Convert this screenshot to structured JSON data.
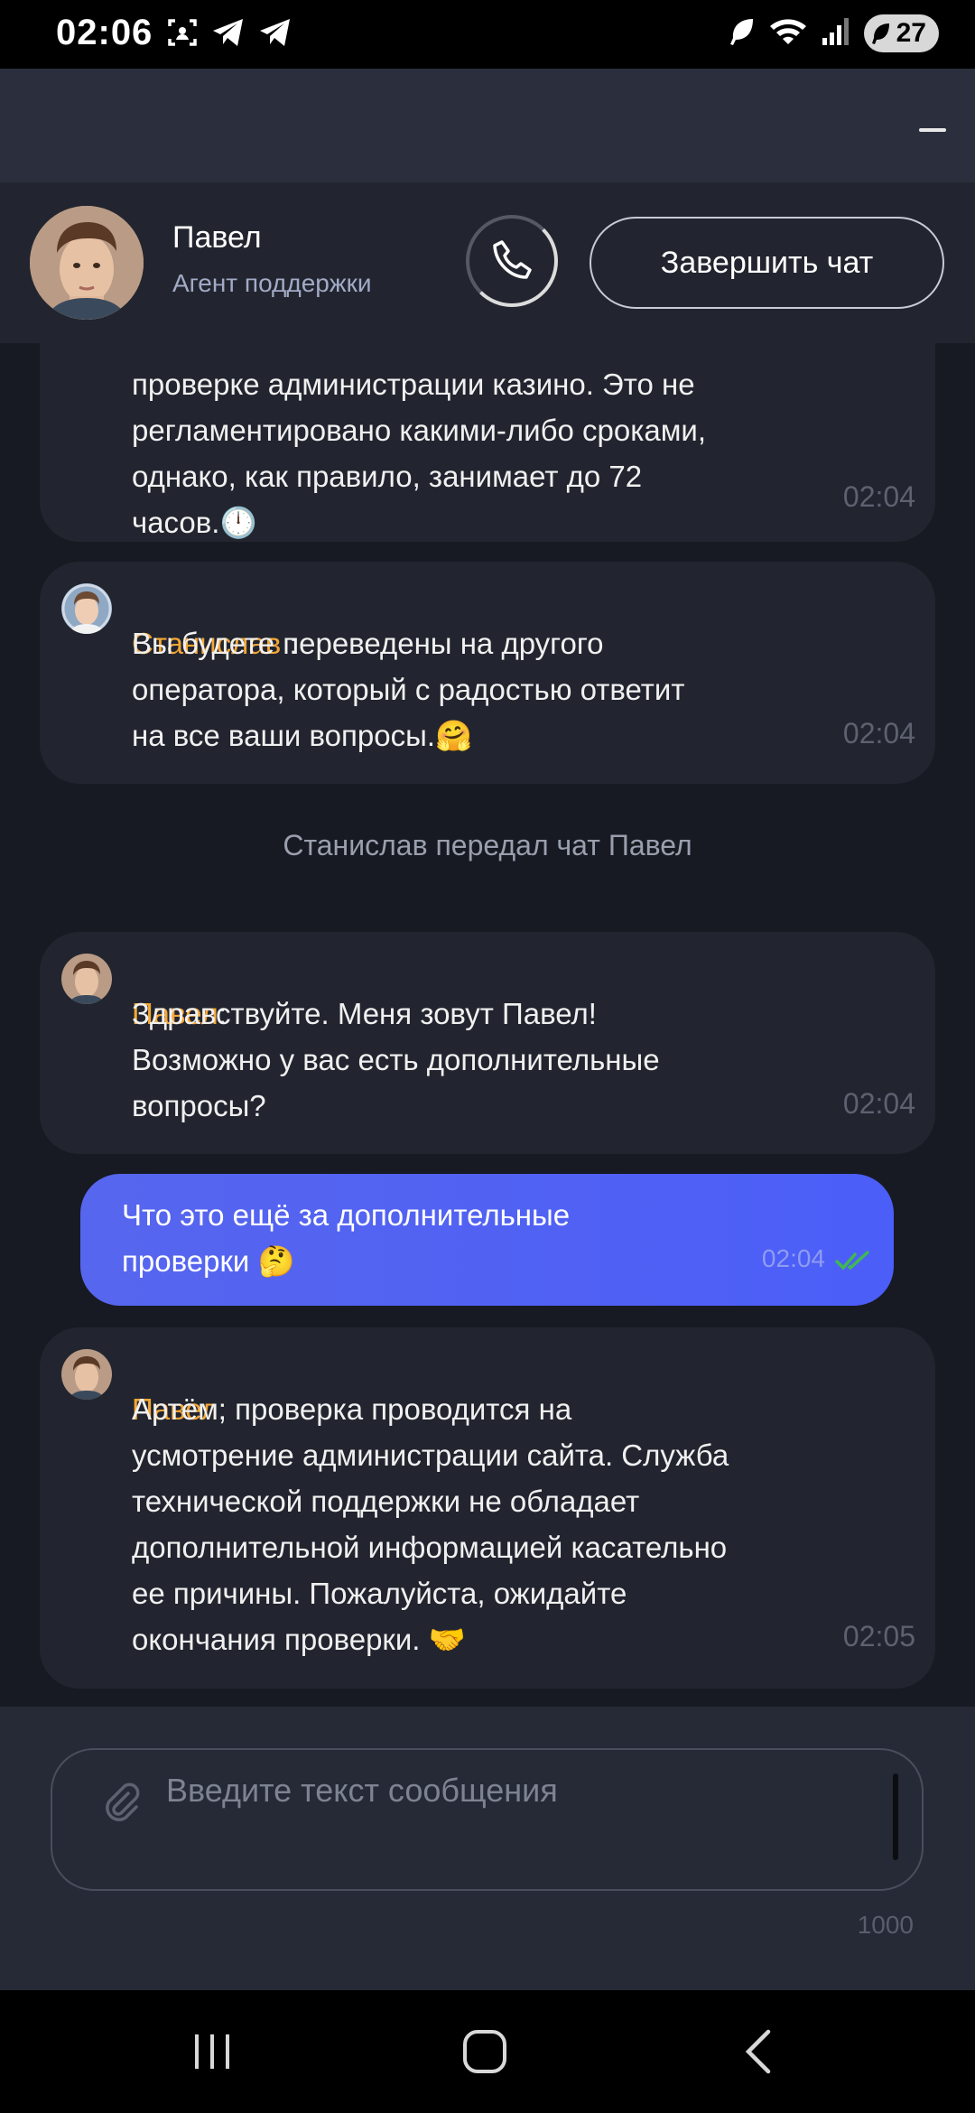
{
  "status_bar": {
    "time": "02:06",
    "battery": "27",
    "icons": [
      "screenshot-icon",
      "telegram-icon",
      "telegram-icon",
      "leaf-icon",
      "wifi-icon",
      "signal-icon",
      "battery-icon"
    ]
  },
  "header": {
    "agent_name": "Павел",
    "agent_role": "Агент поддержки",
    "end_chat_label": "Завершить чат",
    "call_icon": "phone-icon",
    "minimize_icon": "minimize-icon"
  },
  "messages": [
    {
      "type": "incoming",
      "sender": "",
      "text": "проверке администрации казино. Это не\nрегламентировано какими-либо сроками,\nоднако, как правило, занимает до 72\nчасов.🕛",
      "time": "02:04"
    },
    {
      "type": "incoming",
      "sender": "Станислав",
      "sender_separator": " :",
      "text": "Вы будете переведены на другого\nоператора, который с радостью ответит\nна все ваши вопросы.🤗",
      "time": "02:04"
    },
    {
      "type": "system",
      "text": "Станислав передал чат Павел"
    },
    {
      "type": "incoming",
      "sender": "Павел",
      "sender_separator": ":",
      "text": "Здравствуйте. Меня зовут Павел!\nВозможно у вас есть дополнительные\nвопросы?",
      "time": "02:04"
    },
    {
      "type": "outgoing",
      "text": "Что это ещё за дополнительные\nпроверки 🤔",
      "time": "02:04",
      "status": "read"
    },
    {
      "type": "incoming",
      "sender": "Павел",
      "sender_separator": ":",
      "text": "Артём, проверка проводится на\nусмотрение администрации сайта. Служба\nтехнической поддержки не обладает\nдополнительной информацией касательно\nее причины. Пожалуйста, ожидайте\nокончания проверки. 🤝",
      "time": "02:05"
    }
  ],
  "input": {
    "placeholder": "Введите текст сообщения",
    "char_limit": "1000",
    "attach_icon": "paperclip-icon"
  },
  "nav_bar": {
    "icons": [
      "recent-apps-icon",
      "home-icon",
      "back-icon"
    ]
  },
  "colors": {
    "sender_name": "#f4a635",
    "outgoing_bubble": "#5766ee",
    "incoming_bubble": "#22252f",
    "chat_background": "#171a22",
    "read_check": "#3fb950"
  }
}
